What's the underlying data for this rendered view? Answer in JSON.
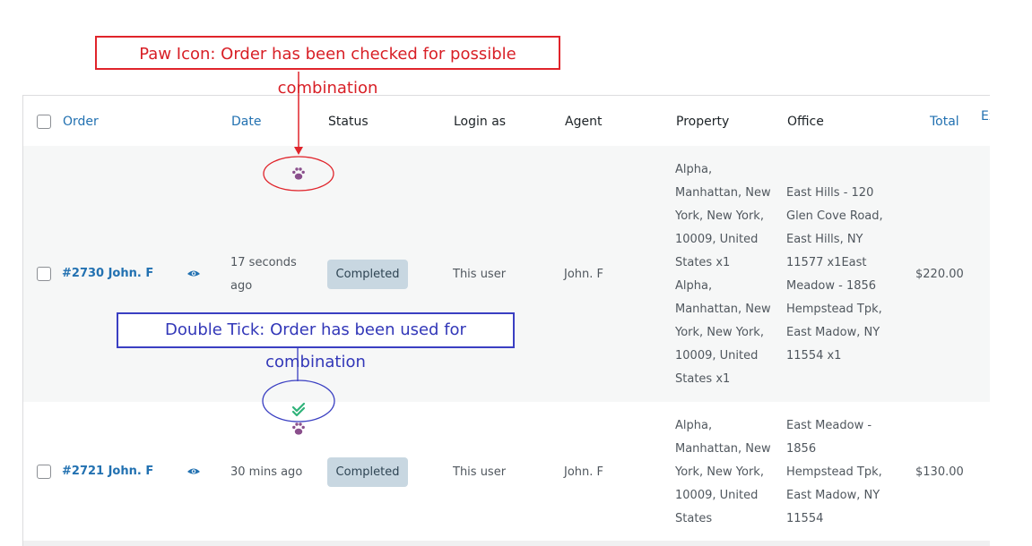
{
  "annotations": {
    "paw": "Paw Icon: Order has been checked for possible combination",
    "double_tick": "Double Tick: Order has been used for combination"
  },
  "table": {
    "headers": {
      "order": "Order",
      "date": "Date",
      "status": "Status",
      "login_as": "Login as",
      "agent": "Agent",
      "property": "Property",
      "office": "Office",
      "total": "Total",
      "extra": "Ex"
    },
    "rows": [
      {
        "order": "#2730 John. F",
        "date_line1": "17 seconds",
        "date_line2": "ago",
        "status": "Completed",
        "login_as": "This user",
        "agent": "John. F",
        "property": [
          "Alpha,",
          "Manhattan, New",
          "York, New York,",
          "10009, United",
          "States x1",
          "Alpha,",
          "Manhattan, New",
          "York, New York,",
          "10009, United",
          "States x1"
        ],
        "office": [
          "East Hills - 120",
          "Glen Cove Road,",
          "East Hills, NY",
          "11577 x1East",
          "Meadow - 1856",
          "Hempstead Tpk,",
          "East Madow, NY",
          "11554 x1"
        ],
        "total": "$220.00"
      },
      {
        "order": "#2721 John. F",
        "date": "30 mins ago",
        "status": "Completed",
        "login_as": "This user",
        "agent": "John. F",
        "property": [
          "Alpha,",
          "Manhattan, New",
          "York, New York,",
          "10009, United",
          "States"
        ],
        "office": [
          "East Meadow -",
          "1856",
          "Hempstead Tpk,",
          "East Madow, NY",
          "11554"
        ],
        "total": "$130.00"
      }
    ]
  },
  "colors": {
    "link": "#2271b1",
    "paw": "#8a4f8c",
    "tick": "#2fb37a",
    "red_callout": "#e0242b",
    "blue_callout": "#3a3fc2",
    "badge_bg": "#c8d7e1"
  },
  "icons": [
    "paw-icon",
    "double-tick-icon",
    "eye-icon",
    "checkbox"
  ]
}
